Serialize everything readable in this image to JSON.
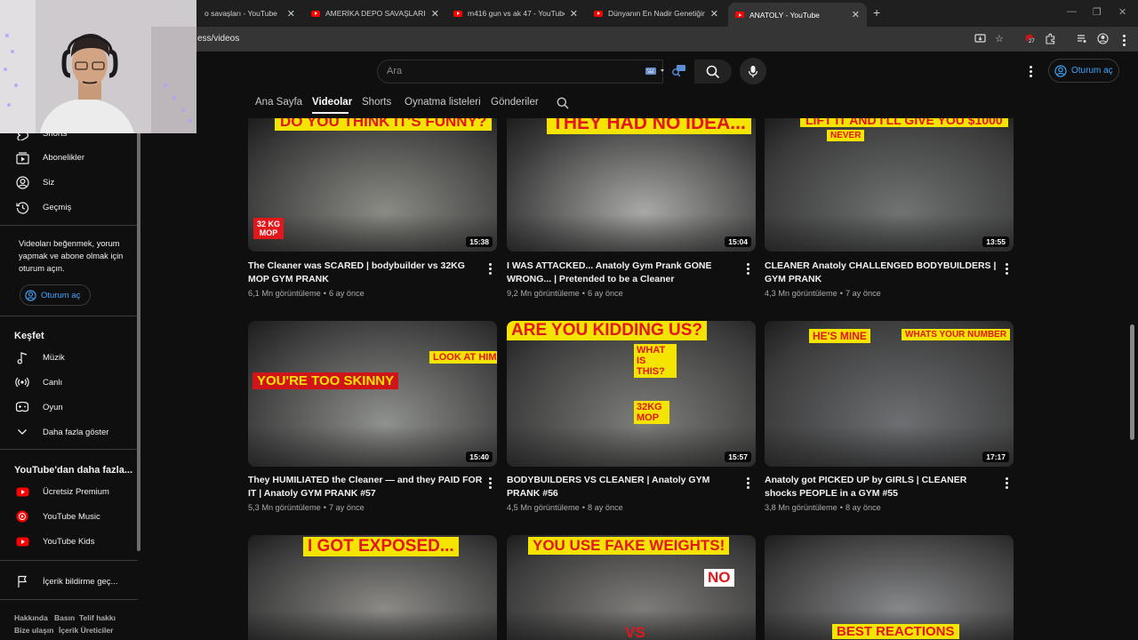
{
  "browser": {
    "tabs": [
      {
        "title": "o savaşları - YouTube",
        "active": false
      },
      {
        "title": "AMERİKA DEPO SAVAŞLARI - Yo",
        "active": false
      },
      {
        "title": "m416 gun vs ak 47 - YouTube",
        "active": false
      },
      {
        "title": "Dünyanın En Nadir Genetiğini A",
        "active": false
      },
      {
        "title": "ANATOLY - YouTube",
        "active": true
      }
    ],
    "url": "ess/videos",
    "ext_badge": "27",
    "window_controls": {
      "minimize": "—",
      "maximize": "❐",
      "close": "✕"
    }
  },
  "header": {
    "search_placeholder": "Ara",
    "signin_label": "Oturum aç"
  },
  "channel_tabs": [
    {
      "label": "Ana Sayfa",
      "active": false
    },
    {
      "label": "Videolar",
      "active": true
    },
    {
      "label": "Shorts",
      "active": false
    },
    {
      "label": "Oynatma listeleri",
      "active": false
    },
    {
      "label": "Gönderiler",
      "active": false
    }
  ],
  "sidebar": {
    "main_items": [
      {
        "label": "Shorts",
        "icon": "shorts-icon"
      },
      {
        "label": "Abonelikler",
        "icon": "subscriptions-icon"
      },
      {
        "label": "Siz",
        "icon": "user-icon"
      },
      {
        "label": "Geçmiş",
        "icon": "history-icon"
      }
    ],
    "signin_prompt": "Videoları beğenmek, yorum yapmak ve abone olmak için oturum açın.",
    "signin_label": "Oturum aç",
    "explore_heading": "Keşfet",
    "explore_items": [
      {
        "label": "Müzik",
        "icon": "music-icon"
      },
      {
        "label": "Canlı",
        "icon": "live-icon"
      },
      {
        "label": "Oyun",
        "icon": "gaming-icon"
      },
      {
        "label": "Daha fazla göster",
        "icon": "chevron-down-icon"
      }
    ],
    "more_heading": "YouTube'dan daha fazla...",
    "more_items": [
      {
        "label": "Ücretsiz Premium",
        "icon": "youtube-premium-icon"
      },
      {
        "label": "YouTube Music",
        "icon": "youtube-music-icon"
      },
      {
        "label": "YouTube Kids",
        "icon": "youtube-kids-icon"
      }
    ],
    "report_label": "İçerik bildirme geç...",
    "footer_links": [
      "Hakkında",
      "Basın",
      "Telif hakkı",
      "Bize ulaşın",
      "İçerik Üreticiler"
    ]
  },
  "videos": [
    {
      "title": "The Cleaner was SCARED | bodybuilder vs 32KG MOP GYM PRANK",
      "views": "6,1 Mn görüntüleme",
      "age": "6 ay önce",
      "duration": "15:38",
      "captions": [
        "DO YOU THINK IT'S FUNNY?",
        "32 KG MOP"
      ],
      "colors": {
        "bg": "#8a8b84",
        "accent": "#e2171b"
      }
    },
    {
      "title": "I WAS ATTACKED... Anatoly Gym Prank GONE WRONG... | Pretended to be a Cleaner",
      "views": "9,2 Mn görüntüleme",
      "age": "6 ay önce",
      "duration": "15:04",
      "captions": [
        "THEY HAD NO IDEA..."
      ],
      "colors": {
        "bg": "#a8a9a6",
        "accent": "#e2171b"
      }
    },
    {
      "title": "CLEANER Anatoly CHALLENGED BODYBUILDERS | GYM PRANK",
      "views": "4,3 Mn görüntüleme",
      "age": "7 ay önce",
      "duration": "13:55",
      "captions": [
        "LIFT IT AND I'LL GIVE YOU $1000",
        "NEVER"
      ],
      "colors": {
        "bg": "#6f7371",
        "accent": "#e2171b"
      }
    },
    {
      "title": "They HUMILIATED the Cleaner — and they PAID FOR IT | Anatoly GYM PRANK #57",
      "views": "5,3 Mn görüntüleme",
      "age": "7 ay önce",
      "duration": "15:40",
      "captions": [
        "YOU'RE TOO SKINNY",
        "LOOK AT HIM"
      ],
      "colors": {
        "bg": "#8f918d",
        "accent": "#e2171b"
      }
    },
    {
      "title": "BODYBUILDERS VS CLEANER | Anatoly GYM PRANK #56",
      "views": "4,5 Mn görüntüleme",
      "age": "8 ay önce",
      "duration": "15:57",
      "captions": [
        "ARE YOU KIDDING US?",
        "WHAT IS THIS?",
        "32KG MOP"
      ],
      "colors": {
        "bg": "#7d7e7a",
        "accent": "#e2171b"
      }
    },
    {
      "title": "Anatoly got PICKED UP by GIRLS | CLEANER shocks PEOPLE in a GYM #55",
      "views": "3,8 Mn görüntüleme",
      "age": "8 ay önce",
      "duration": "17:17",
      "captions": [
        "HE'S MINE",
        "WHATS YOUR NUMBER"
      ],
      "colors": {
        "bg": "#6d6f72",
        "accent": "#e2171b"
      }
    },
    {
      "title": "",
      "views": "",
      "age": "",
      "duration": "",
      "captions": [
        "I GOT EXPOSED..."
      ],
      "colors": {
        "bg": "#8b8a86",
        "accent": "#e2171b"
      }
    },
    {
      "title": "",
      "views": "",
      "age": "",
      "duration": "",
      "captions": [
        "YOU USE FAKE WEIGHTS!",
        "NO",
        "VS"
      ],
      "colors": {
        "bg": "#7e7c79",
        "accent": "#e2171b"
      }
    },
    {
      "title": "",
      "views": "",
      "age": "",
      "duration": "",
      "captions": [
        "BEST REACTIONS"
      ],
      "colors": {
        "bg": "#87888a",
        "accent": "#e2171b"
      }
    }
  ]
}
